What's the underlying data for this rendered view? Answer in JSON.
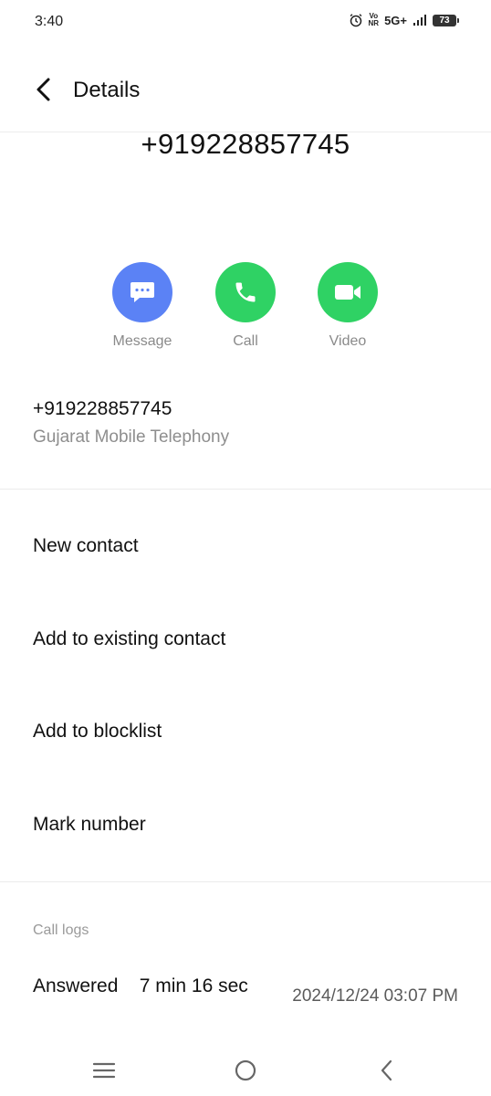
{
  "status_bar": {
    "time": "3:40",
    "volte_top": "Vo",
    "volte_bottom": "NR",
    "network": "5G+",
    "battery": "73"
  },
  "header": {
    "title": "Details"
  },
  "phone_number": "+919228857745",
  "actions": [
    {
      "label": "Message",
      "icon": "message-icon",
      "color": "#5b82f5"
    },
    {
      "label": "Call",
      "icon": "phone-icon",
      "color": "#2fd264"
    },
    {
      "label": "Video",
      "icon": "video-icon",
      "color": "#2fd264"
    }
  ],
  "number_info": {
    "number": "+919228857745",
    "carrier": "Gujarat Mobile Telephony"
  },
  "menu": [
    {
      "label": "New contact"
    },
    {
      "label": "Add to existing contact"
    },
    {
      "label": "Add to blocklist"
    },
    {
      "label": "Mark number"
    }
  ],
  "call_logs": {
    "section_label": "Call logs",
    "entries": [
      {
        "status": "Answered    7 min 16 sec",
        "datetime": "2024/12/24 03:07 PM"
      }
    ]
  }
}
